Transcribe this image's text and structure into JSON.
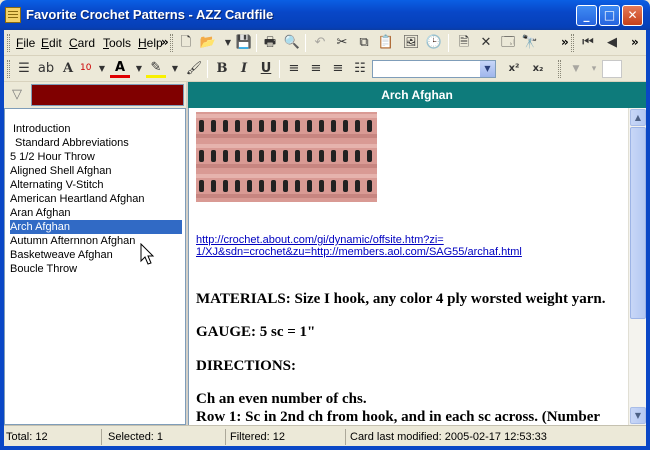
{
  "window": {
    "title": "Favorite Crochet Patterns - AZZ Cardfile",
    "minimize_glyph": "_",
    "maximize_glyph": "□",
    "close_glyph": "✕"
  },
  "menu": {
    "items": [
      "File",
      "Edit",
      "Card",
      "Tools",
      "Help"
    ]
  },
  "toolbar": {
    "font_size": "10",
    "more_glyph": "»",
    "font_combo_value": ""
  },
  "filter": {
    "value": ""
  },
  "list": {
    "items": [
      "Introduction",
      "Standard Abbreviations",
      "5 1/2 Hour Throw",
      "Aligned Shell Afghan",
      "Alternating V-Stitch",
      "American Heartland Afghan",
      "Aran Afghan",
      "Arch Afghan",
      "Autumn Afternnon Afghan",
      "Basketweave Afghan",
      "Boucle Throw"
    ],
    "selected_index": 7
  },
  "card": {
    "title": "Arch Afghan",
    "link_line1": "http://crochet.about.com/gi/dynamic/offsite.htm?zi=",
    "link_line2": "1/XJ&sdn=crochet&zu=http://members.aol.com/SAG55/archaf.html",
    "materials": "MATERIALS: Size I hook, any color 4 ply worsted weight yarn.",
    "gauge": "GAUGE: 5 sc = 1\"",
    "directions": "DIRECTIONS:",
    "line_ch": "Ch an even number of chs.",
    "line_row1": "Row 1: Sc in 2nd ch from hook, and in each sc across. (Number"
  },
  "colors": {
    "title_bar": "#0846c6",
    "card_header": "#0e7b7b",
    "filter_field": "#800000",
    "selection": "#316ac5",
    "yarn": "#d99a94"
  },
  "status": {
    "total": "Total: 12",
    "selected": "Selected: 1",
    "filtered": "Filtered: 12",
    "modified": "Card last modified: 2005-02-17  12:53:33"
  }
}
